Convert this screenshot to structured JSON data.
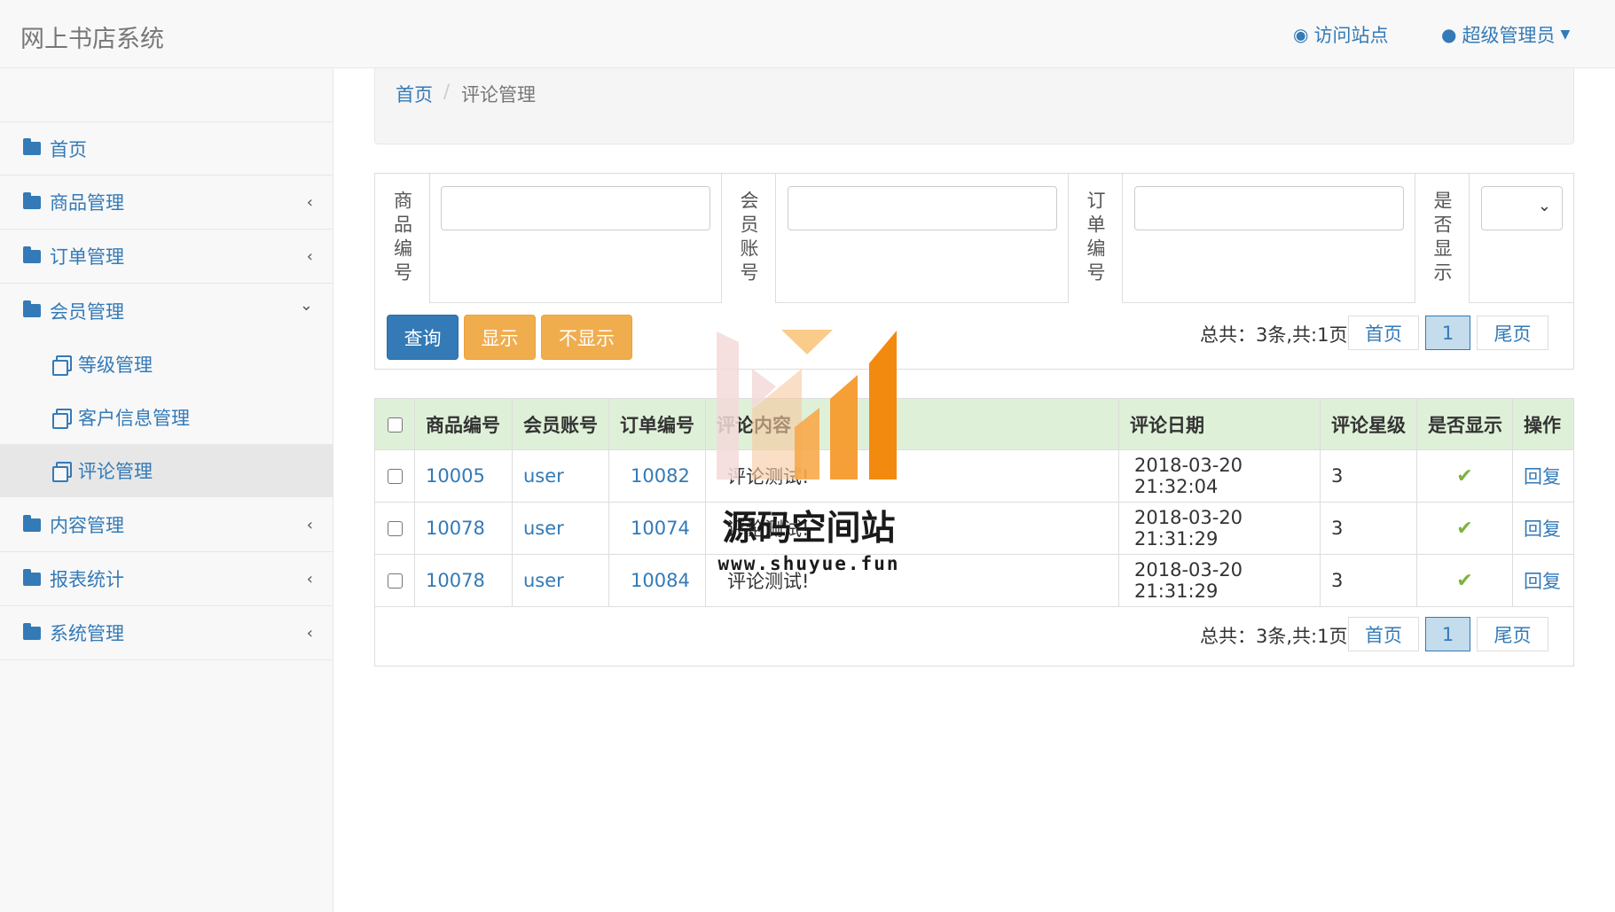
{
  "app": {
    "title": "网上书店系统"
  },
  "header": {
    "visit_icon": "globe-icon",
    "visit_label": "访问站点",
    "user_icon": "user-icon",
    "user_label": "超级管理员"
  },
  "sidebar": {
    "items": [
      {
        "label": "首页",
        "icon": "folder-icon",
        "caret": ""
      },
      {
        "label": "商品管理",
        "icon": "folder-icon",
        "caret": "‹"
      },
      {
        "label": "订单管理",
        "icon": "folder-icon",
        "caret": "‹"
      },
      {
        "label": "会员管理",
        "icon": "folder-open-icon",
        "caret": "⌄"
      },
      {
        "label": "内容管理",
        "icon": "folder-icon",
        "caret": "‹"
      },
      {
        "label": "报表统计",
        "icon": "folder-icon",
        "caret": "‹"
      },
      {
        "label": "系统管理",
        "icon": "folder-icon",
        "caret": "‹"
      }
    ],
    "sub_items": [
      {
        "label": "等级管理",
        "icon": "copy-icon"
      },
      {
        "label": "客户信息管理",
        "icon": "copy-icon"
      },
      {
        "label": "评论管理",
        "icon": "copy-icon",
        "active": true
      }
    ]
  },
  "breadcrumb": {
    "home": "首页",
    "separator": "/",
    "current": "评论管理"
  },
  "search": {
    "labels": [
      "商品编号",
      "会员账号",
      "订单编号",
      "是否显示"
    ],
    "values": [
      "",
      "",
      ""
    ],
    "select_value": "",
    "buttons": {
      "query": "查询",
      "show": "显示",
      "hide": "不显示"
    }
  },
  "pagination": {
    "summary": "总共：3条,共:1页",
    "first": "首页",
    "current": "1",
    "last": "尾页"
  },
  "table": {
    "headers": [
      "商品编号",
      "会员账号",
      "订单编号",
      "评论内容",
      "评论日期",
      "评论星级",
      "是否显示",
      "操作"
    ],
    "rows": [
      {
        "product": "10005",
        "member": "user",
        "order": "10082",
        "content": "评论测试!",
        "date": "2018-03-20 21:32:04",
        "stars": "3",
        "shown": "✔",
        "action": "回复"
      },
      {
        "product": "10078",
        "member": "user",
        "order": "10074",
        "content": "评论测试!",
        "date": "2018-03-20 21:31:29",
        "stars": "3",
        "shown": "✔",
        "action": "回复"
      },
      {
        "product": "10078",
        "member": "user",
        "order": "10084",
        "content": "评论测试!",
        "date": "2018-03-20 21:31:29",
        "stars": "3",
        "shown": "✔",
        "action": "回复"
      }
    ]
  },
  "watermark": {
    "title": "源码空间站",
    "url": "www.shuyue.fun"
  },
  "colors": {
    "primary": "#337ab7",
    "warning": "#f0ad4e",
    "header_row": "#dff0d8",
    "check": "#7cb342"
  }
}
